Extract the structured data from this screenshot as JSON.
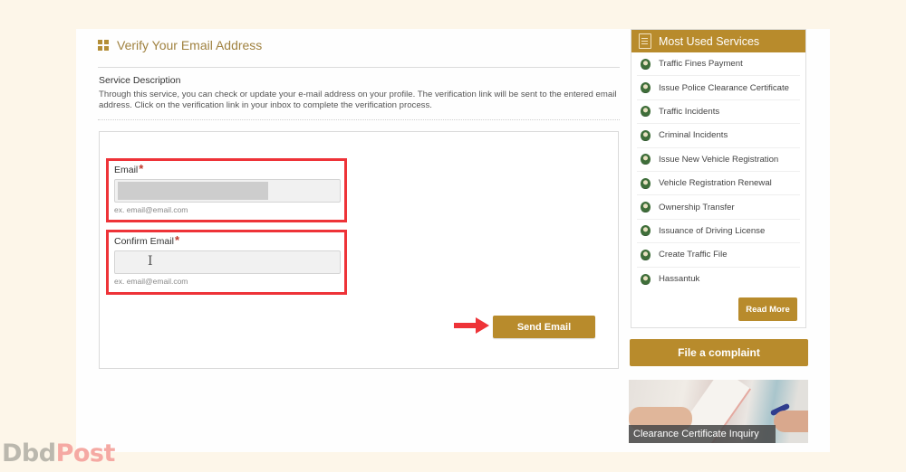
{
  "main": {
    "title": "Verify Your Email Address",
    "description_heading": "Service Description",
    "description_text": "Through this service, you can check or update your e-mail address on your profile. The verification link will be sent to the entered email address. Click on the verification link in your inbox to complete the verification process.",
    "form": {
      "email": {
        "label": "Email",
        "required_mark": "*",
        "value": "",
        "hint": "ex. email@email.com",
        "masked": true
      },
      "confirm_email": {
        "label": "Confirm Email",
        "required_mark": "*",
        "value": "",
        "hint": "ex. email@email.com",
        "cursor_glyph": "I"
      },
      "submit_label": "Send Email"
    },
    "highlight_color": "#ee3338"
  },
  "sidebar": {
    "title": "Most Used Services",
    "items": [
      {
        "label": "Traffic Fines Payment"
      },
      {
        "label": "Issue Police Clearance Certificate"
      },
      {
        "label": "Traffic Incidents"
      },
      {
        "label": "Criminal Incidents"
      },
      {
        "label": "Issue New Vehicle Registration"
      },
      {
        "label": "Vehicle Registration Renewal"
      },
      {
        "label": "Ownership Transfer"
      },
      {
        "label": "Issuance of Driving License"
      },
      {
        "label": "Create Traffic File"
      },
      {
        "label": "Hassantuk"
      }
    ],
    "read_more_label": "Read More",
    "complaint_label": "File a complaint",
    "promo_caption": "Clearance Certificate Inquiry"
  },
  "watermark": {
    "part1": "Dbd",
    "part2": "Post"
  },
  "colors": {
    "accent": "#b88b2c",
    "title": "#a08240",
    "background": "#fdf6e9"
  }
}
